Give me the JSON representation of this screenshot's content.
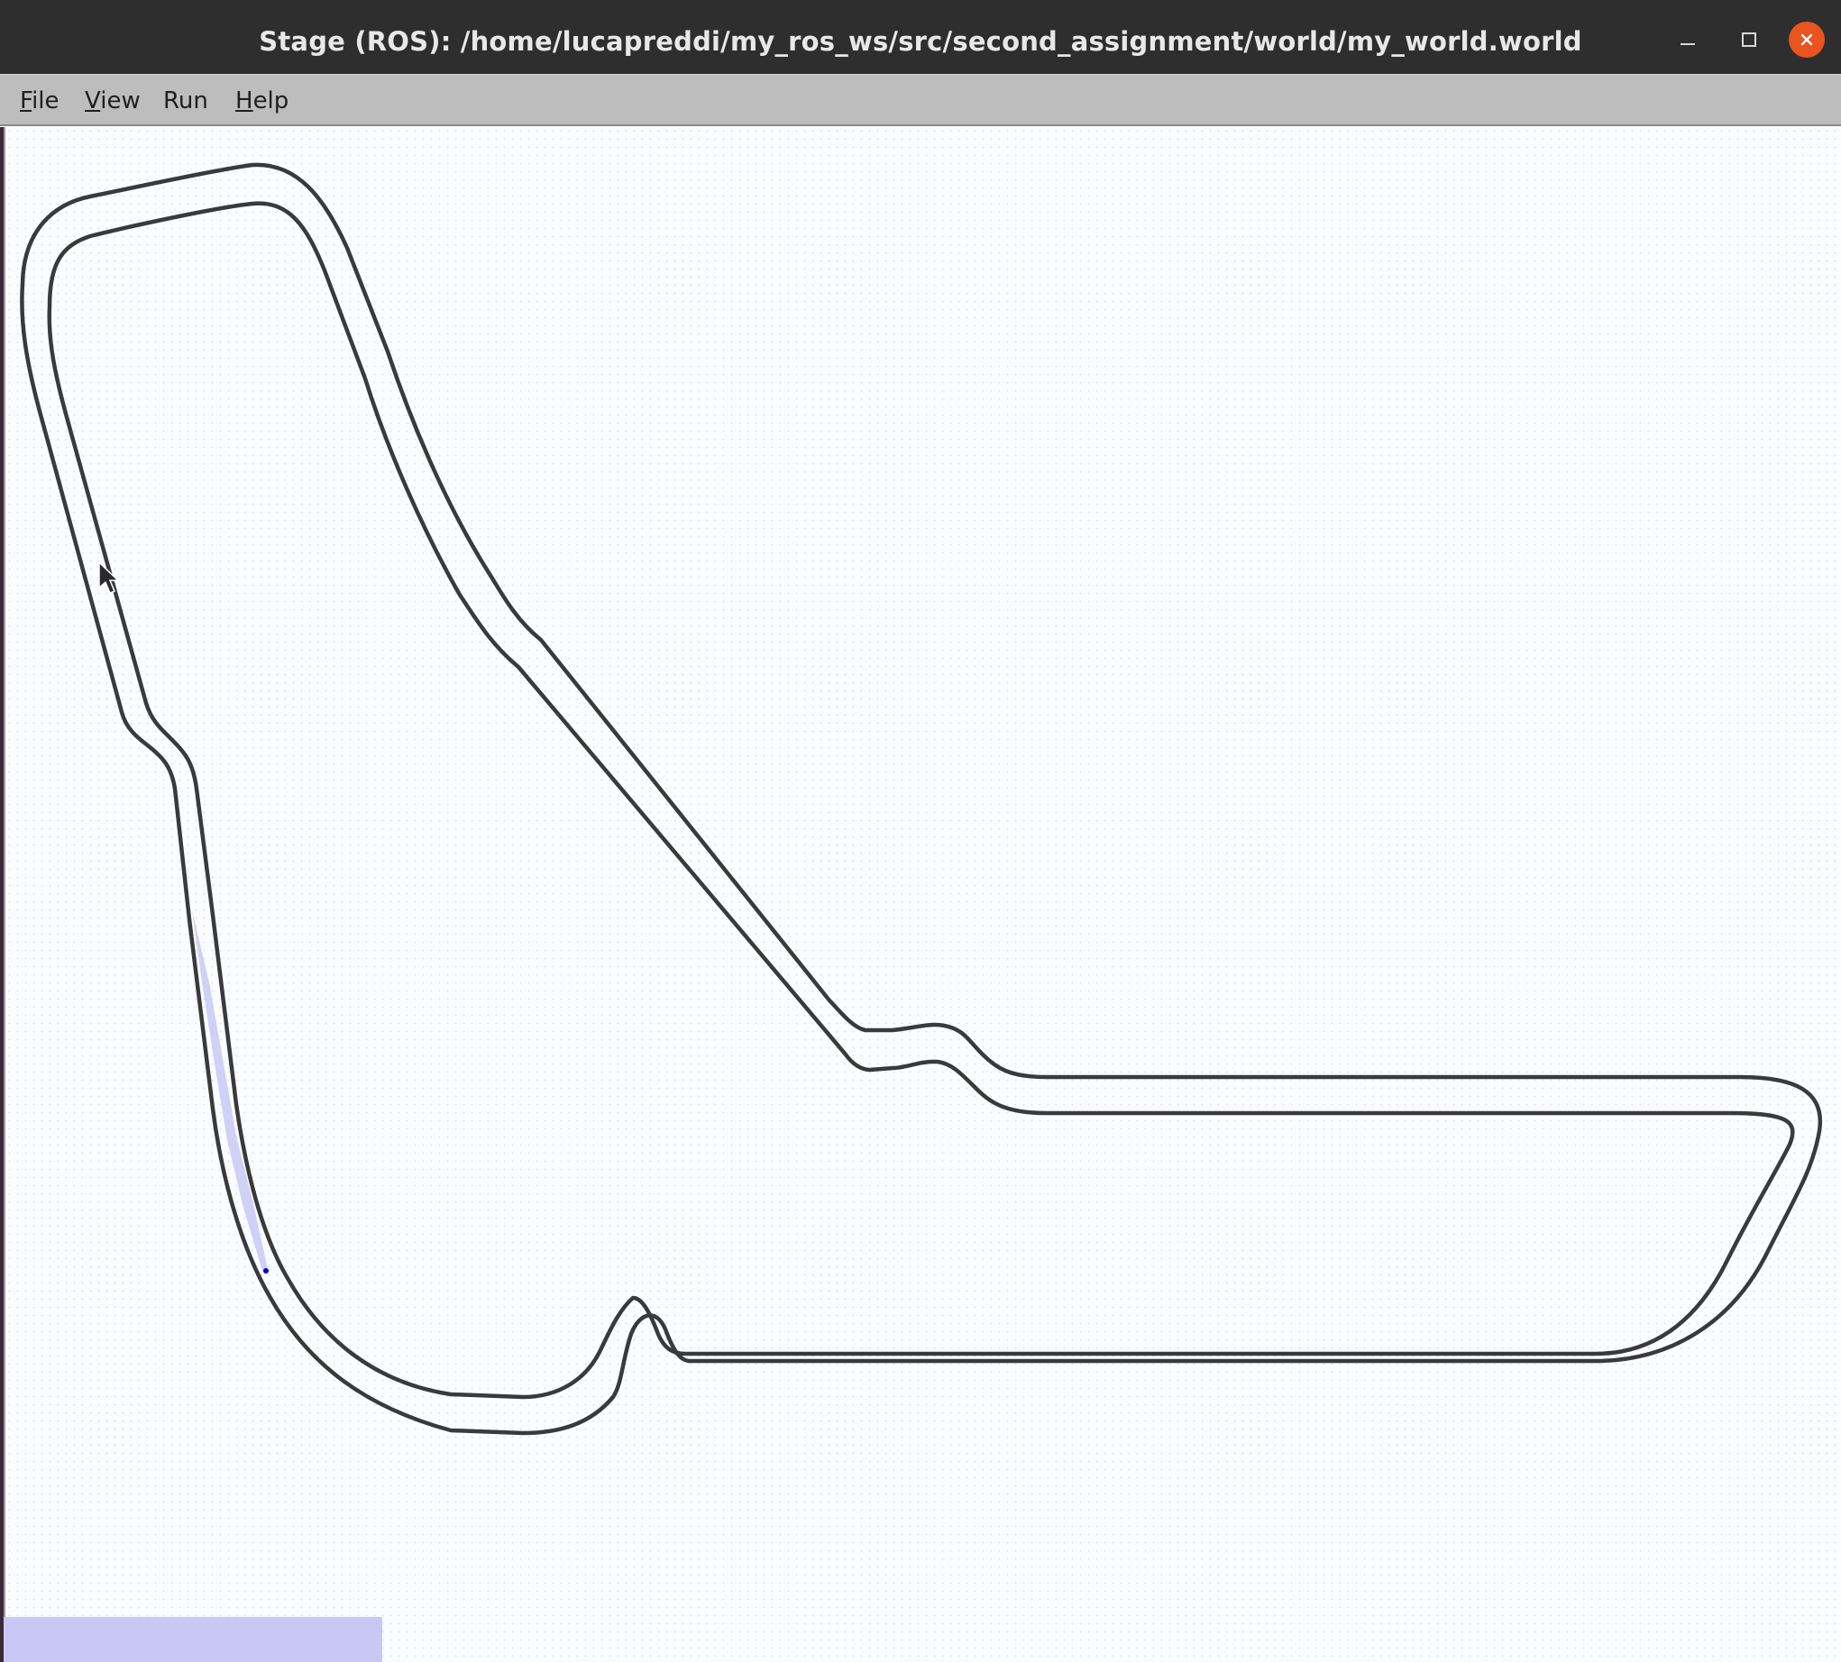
{
  "window": {
    "title": "Stage (ROS): /home/lucapreddi/my_ros_ws/src/second_assignment/world/my_world.world"
  },
  "window_controls": {
    "minimize_icon": "minimize-icon",
    "maximize_icon": "maximize-icon",
    "close_icon": "close-icon",
    "close_color": "#e9541f"
  },
  "menu": {
    "file": {
      "accel": "F",
      "rest": "ile"
    },
    "view": {
      "accel": "V",
      "rest": "iew"
    },
    "run": {
      "label": "Run"
    },
    "help": {
      "accel": "H",
      "rest": "elp"
    }
  },
  "colors": {
    "track_wall": "#3a3a3a",
    "laser_scan": "#c7c7f5",
    "robot": "#0000cc",
    "status_bar": "#c9c8f4"
  }
}
